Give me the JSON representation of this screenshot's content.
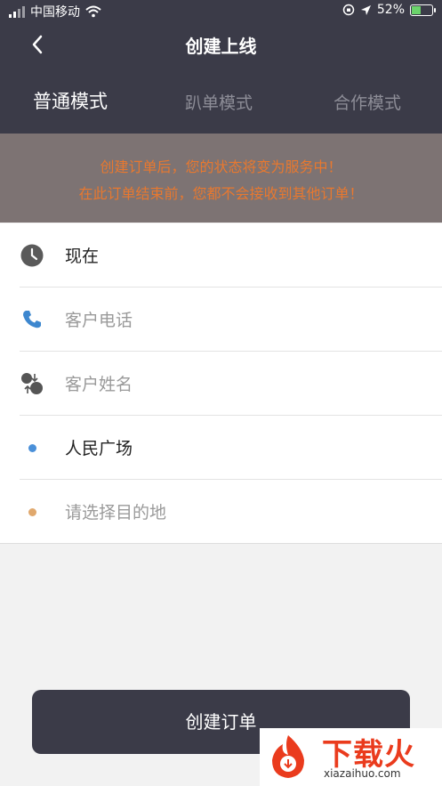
{
  "status_bar": {
    "carrier": "中国移动",
    "battery": "52%",
    "battery_fraction": 0.52
  },
  "nav": {
    "title": "创建上线"
  },
  "tabs": [
    {
      "label": "普通模式",
      "active": true
    },
    {
      "label": "趴单模式",
      "active": false
    },
    {
      "label": "合作模式",
      "active": false
    }
  ],
  "notice": {
    "line1": "创建订单后，您的状态将变为服务中！",
    "line2": "在此订单结束前，您都不会接收到其他订单！"
  },
  "form": {
    "time": {
      "value": "现在",
      "icon": "clock-icon"
    },
    "phone": {
      "placeholder": "客户电话",
      "icon": "phone-icon"
    },
    "name": {
      "placeholder": "客户姓名",
      "icon": "person-icon"
    },
    "origin": {
      "value": "人民广场",
      "dot_color": "#4a90d9"
    },
    "destination": {
      "placeholder": "请选择目的地",
      "dot_color": "#e0a86d"
    }
  },
  "actions": {
    "create_label": "创建订单"
  },
  "watermark": {
    "brand": "下载火",
    "site": "xiazaihuo.com"
  },
  "colors": {
    "header": "#3b3b48",
    "notice_bg": "#7d7373",
    "notice_text": "#e8782f",
    "accent": "#ea3b1d"
  }
}
